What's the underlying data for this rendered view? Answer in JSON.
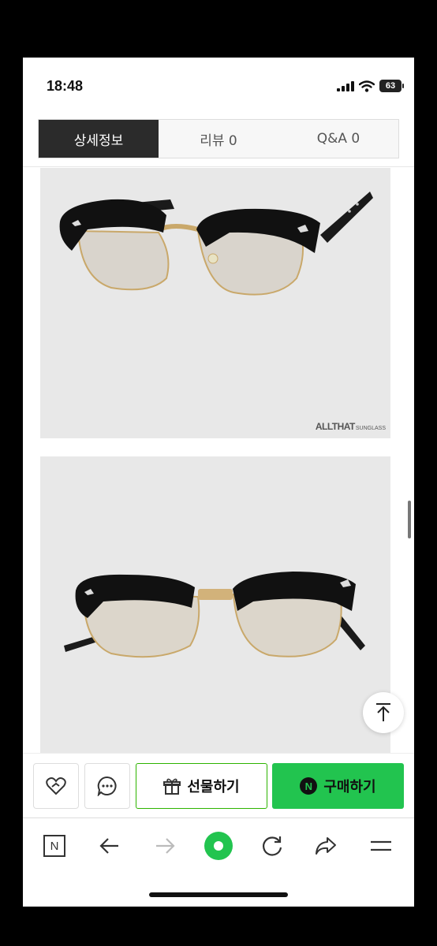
{
  "status_bar": {
    "time": "18:48",
    "battery": "63"
  },
  "tabs": [
    {
      "label": "상세정보",
      "active": true
    },
    {
      "label": "리뷰  0",
      "active": false
    },
    {
      "label": "Q&A  0",
      "active": false
    }
  ],
  "product_images": [
    {
      "watermark_main": "ALLTHAT",
      "watermark_sub": "SUNGLASS"
    }
  ],
  "actions": {
    "gift_label": "선물하기",
    "buy_label": "구매하기",
    "npay_badge": "N"
  },
  "browser_nav": {
    "home_label": "N"
  },
  "colors": {
    "accent_green": "#22c44f",
    "tab_active_bg": "#2b2b2b",
    "image_bg": "#e8e8e8"
  }
}
